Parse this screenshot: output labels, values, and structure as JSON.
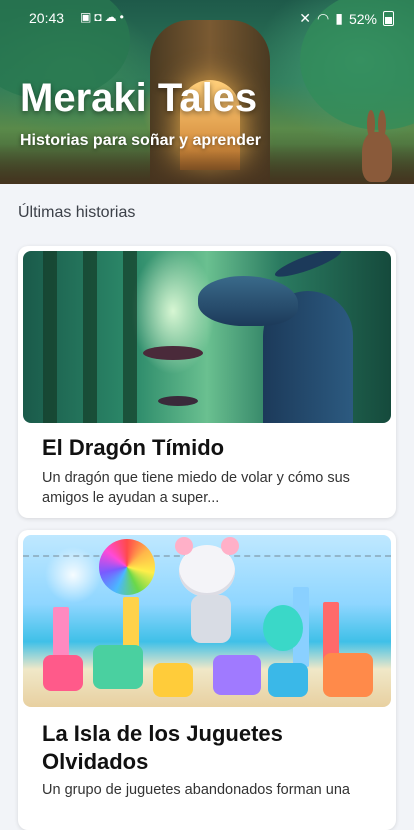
{
  "status_bar": {
    "time": "20:43",
    "battery": "52%"
  },
  "header": {
    "title": "Meraki Tales",
    "subtitle": "Historias para soñar y aprender"
  },
  "section": {
    "title": "Últimas historias"
  },
  "stories": [
    {
      "title": "El Dragón Tímido",
      "description": "Un dragón que tiene miedo de volar y cómo sus amigos le ayudan a super..."
    },
    {
      "title": "La Isla de los Juguetes Olvidados",
      "description": "Un grupo de juguetes abandonados forman una"
    }
  ]
}
